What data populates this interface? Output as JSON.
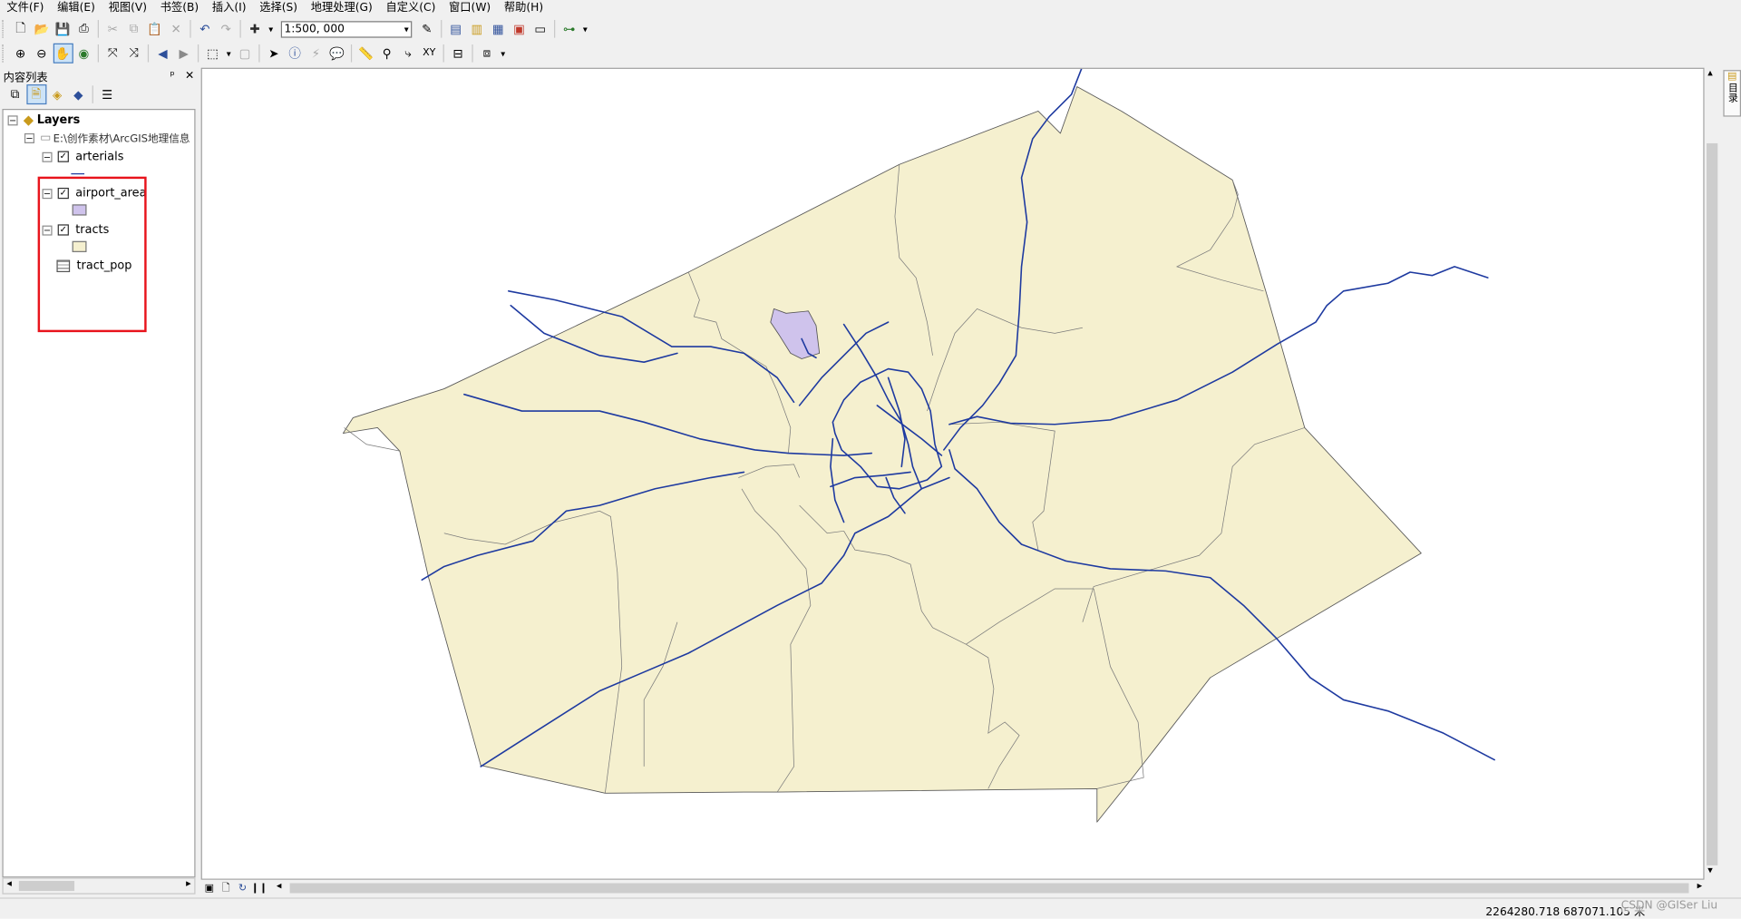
{
  "menubar": {
    "items": [
      "文件(F)",
      "编辑(E)",
      "视图(V)",
      "书签(B)",
      "插入(I)",
      "选择(S)",
      "地理处理(G)",
      "自定义(C)",
      "窗口(W)",
      "帮助(H)"
    ]
  },
  "toolbar": {
    "scale": "1:500, 000"
  },
  "toc": {
    "title": "内容列表",
    "pin": "ᵖ",
    "close": "✕",
    "root_label": "Layers",
    "folder_label": "E:\\创作素材\\ArcGIS地理信息",
    "layers": [
      {
        "label": "arterials",
        "checked": true
      },
      {
        "label": "airport_area",
        "checked": true
      },
      {
        "label": "tracts",
        "checked": true
      }
    ],
    "table_label": "tract_pop"
  },
  "status": {
    "coords": "2264280.718  687071.105 米",
    "watermark": "CSDN @GISer Liu"
  },
  "side_tab_label": "目录",
  "colors": {
    "tract_fill": "#f5f0cf",
    "airport_fill": "#cfc3ec",
    "road": "#1e3aa0",
    "highlight": "#e8141c"
  }
}
